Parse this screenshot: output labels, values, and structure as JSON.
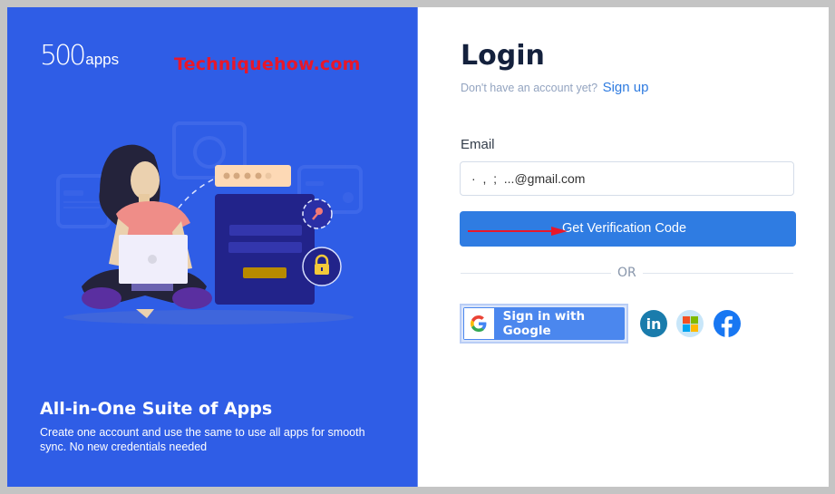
{
  "brand": {
    "logo_number": "500",
    "logo_suffix": "apps",
    "watermark": "Techniquehow.com"
  },
  "promo": {
    "title": "All-in-One Suite of Apps",
    "description": "Create one account and use the same to use all apps for smooth sync. No new credentials needed"
  },
  "login": {
    "title": "Login",
    "signup_prompt": "Don't have an account yet?",
    "signup_link": "Sign up",
    "email_label": "Email",
    "email_value": "·  ,  ;  ...@gmail.com",
    "verify_button": "Get Verification Code",
    "divider_text": "OR",
    "google_button": "Sign in with Google",
    "social": [
      {
        "name": "linkedin",
        "glyph": "in"
      },
      {
        "name": "microsoft",
        "glyph": ""
      },
      {
        "name": "facebook",
        "glyph": "f"
      }
    ]
  },
  "colors": {
    "left_panel": "#2f5de6",
    "primary_button": "#2f7ce2",
    "link": "#2e7be0",
    "watermark": "#e8172a",
    "google_button": "#4b87ee",
    "linkedin": "#1a7cac",
    "facebook": "#1877f2"
  }
}
